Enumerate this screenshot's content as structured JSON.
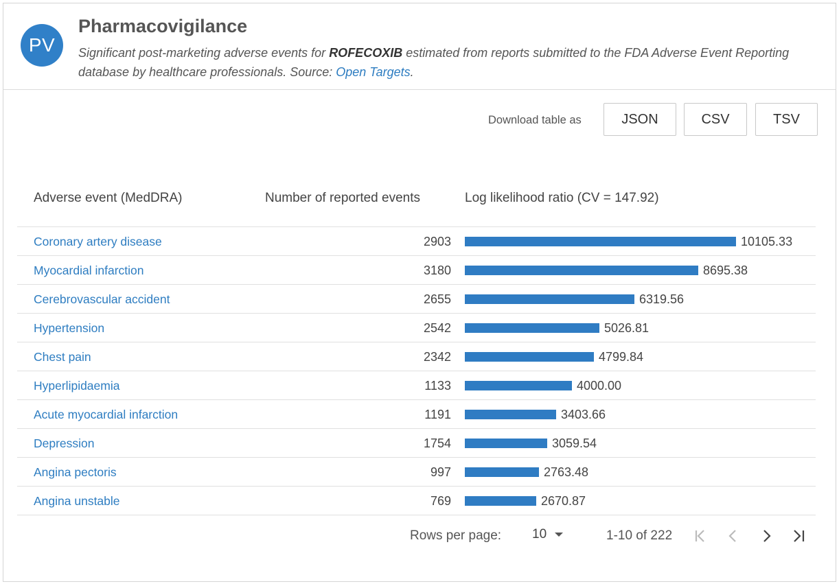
{
  "header": {
    "avatar_text": "PV",
    "title": "Pharmacovigilance",
    "subtitle_pre": "Significant post-marketing adverse events for ",
    "drug": "ROFECOXIB",
    "subtitle_mid": " estimated from reports submitted to the FDA Adverse Event Reporting database by healthcare professionals. Source: ",
    "source_link": "Open Targets",
    "subtitle_post": "."
  },
  "download": {
    "label": "Download table as",
    "json": "JSON",
    "csv": "CSV",
    "tsv": "TSV"
  },
  "table": {
    "columns": [
      "Adverse event (MedDRA)",
      "Number of reported events",
      "Log likelihood ratio (CV = 147.92)"
    ],
    "bar_max": 10105.33,
    "rows": [
      {
        "event": "Coronary artery disease",
        "count": "2903",
        "llr": 10105.33,
        "llr_label": "10105.33"
      },
      {
        "event": "Myocardial infarction",
        "count": "3180",
        "llr": 8695.38,
        "llr_label": "8695.38"
      },
      {
        "event": "Cerebrovascular accident",
        "count": "2655",
        "llr": 6319.56,
        "llr_label": "6319.56"
      },
      {
        "event": "Hypertension",
        "count": "2542",
        "llr": 5026.81,
        "llr_label": "5026.81"
      },
      {
        "event": "Chest pain",
        "count": "2342",
        "llr": 4799.84,
        "llr_label": "4799.84"
      },
      {
        "event": "Hyperlipidaemia",
        "count": "1133",
        "llr": 4000.0,
        "llr_label": "4000.00"
      },
      {
        "event": "Acute myocardial infarction",
        "count": "1191",
        "llr": 3403.66,
        "llr_label": "3403.66"
      },
      {
        "event": "Depression",
        "count": "1754",
        "llr": 3059.54,
        "llr_label": "3059.54"
      },
      {
        "event": "Angina pectoris",
        "count": "997",
        "llr": 2763.48,
        "llr_label": "2763.48"
      },
      {
        "event": "Angina unstable",
        "count": "769",
        "llr": 2670.87,
        "llr_label": "2670.87"
      }
    ]
  },
  "pagination": {
    "rows_per_page_label": "Rows per page:",
    "rows_per_page": "10",
    "range": "1-10 of 222",
    "icons": [
      "first-page-icon",
      "previous-page-icon",
      "next-page-icon",
      "last-page-icon"
    ]
  },
  "colors": {
    "accent": "#2f7cc3",
    "link": "#2e7dc1"
  }
}
